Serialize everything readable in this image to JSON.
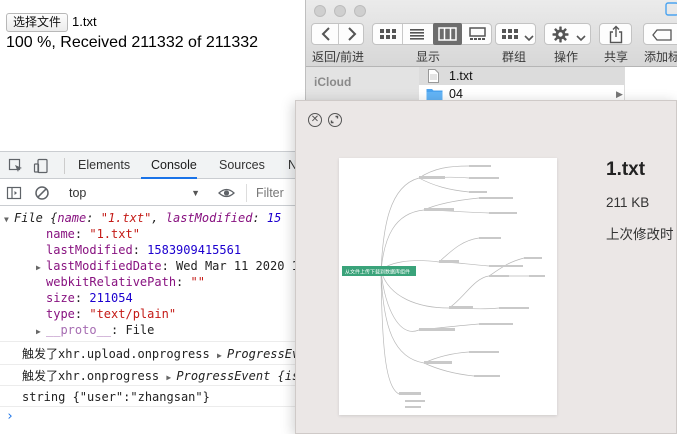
{
  "browser_page": {
    "choose_file_label": "选择文件",
    "selected_file": "1.txt",
    "progress_text": "100 %,  Received 211332 of 211332"
  },
  "devtools": {
    "tabs": [
      "Elements",
      "Console",
      "Sources",
      "N"
    ],
    "active_tab": "Console",
    "context": "top",
    "filter_placeholder": "Filter",
    "console": {
      "file_obj": {
        "head_prefix": "File {",
        "head_name_key": "name",
        "head_name_val": "\"1.txt\"",
        "head_lm_key": "lastModified",
        "head_lm_val": "15"
      },
      "props": {
        "name_key": "name",
        "name_val": "\"1.txt\"",
        "last_modified_key": "lastModified",
        "last_modified_val": "1583909415561",
        "last_modified_date_key": "lastModifiedDate",
        "last_modified_date_val": "Wed Mar 11 2020 1",
        "webkit_path_key": "webkitRelativePath",
        "webkit_path_val": "\"\"",
        "size_key": "size",
        "size_val": "211054",
        "type_key": "type",
        "type_val": "\"text/plain\"",
        "proto_key": "__proto__",
        "proto_val": "File"
      },
      "log1_text": "触发了xhr.upload.onprogress",
      "log1_obj": "ProgressEve",
      "log2_text": "触发了xhr.onprogress",
      "log2_obj": "ProgressEvent {is",
      "log3_text": "string {\"user\":\"zhangsan\"}",
      "prompt": "›"
    }
  },
  "finder": {
    "toolbar": {
      "back_forward_label": "返回/前进",
      "view_label": "显示",
      "group_label": "群组",
      "action_label": "操作",
      "share_label": "共享",
      "add_tag_label": "添加标"
    },
    "sidebar": {
      "section": "iCloud"
    },
    "files": [
      {
        "name": "1.txt",
        "kind": "file"
      },
      {
        "name": "04",
        "kind": "folder"
      }
    ]
  },
  "quicklook": {
    "file_name": "1.txt",
    "file_size": "211 KB",
    "modified_label": "上次修改时",
    "preview_root_label": "从文件上传下载到数据库组件"
  },
  "colors": {
    "accent_blue": "#1a73e8",
    "folder_blue": "#4aa3f0",
    "mindmap_green": "#3aa37a"
  }
}
